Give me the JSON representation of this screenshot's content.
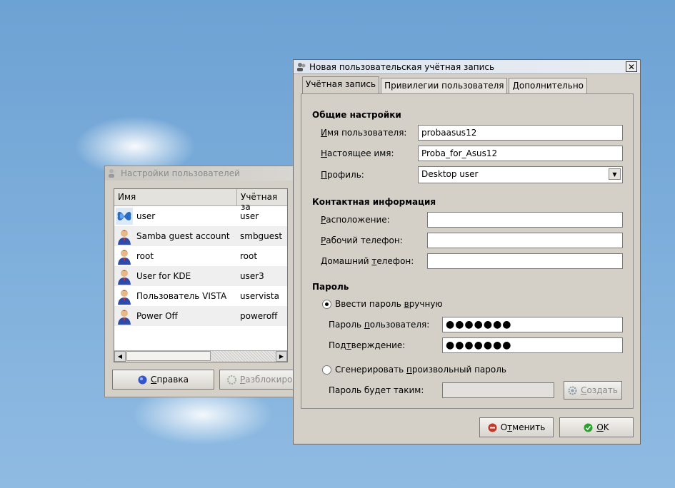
{
  "back_window": {
    "title": "Настройки пользователей",
    "columns": [
      "Имя",
      "Учётная за"
    ],
    "users": [
      {
        "name": "user",
        "account": "user",
        "icon": "butterfly-icon"
      },
      {
        "name": "Samba guest account",
        "account": "smbguest",
        "icon": "user-icon"
      },
      {
        "name": "root",
        "account": "root",
        "icon": "user-icon"
      },
      {
        "name": "User for KDE",
        "account": "user3",
        "icon": "user-icon"
      },
      {
        "name": "Пользователь VISTA",
        "account": "uservista",
        "icon": "user-icon"
      },
      {
        "name": "Power Off",
        "account": "poweroff",
        "icon": "user-icon"
      }
    ],
    "help_button_prefix": "",
    "help_button_mnemonic": "С",
    "help_button_rest": "правка",
    "unlock_button_mnemonic": "Р",
    "unlock_button_rest": "азблокиро"
  },
  "dialog": {
    "title": "Новая пользовательская учётная запись",
    "close_glyph": "✕",
    "tabs": [
      "Учётная запись",
      "Привилегии пользователя",
      "Дополнительно"
    ],
    "general": {
      "heading": "Общие настройки",
      "username_label_m": "И",
      "username_label_rest": "мя пользователя:",
      "username_value": "probaasus12",
      "realname_label_m": "Н",
      "realname_label_rest": "астоящее имя:",
      "realname_value": "Proba_for_Asus12",
      "profile_label_m": "П",
      "profile_label_rest": "рофиль:",
      "profile_value": "Desktop user"
    },
    "contact": {
      "heading": "Контактная информация",
      "location_m": "Р",
      "location_rest": "асположение:",
      "location_value": "",
      "work_phone_m": "Р",
      "work_phone_rest": "абочий телефон:",
      "work_phone_value": "",
      "home_phone_pre": "Домашний ",
      "home_phone_m": "т",
      "home_phone_rest": "елефон:",
      "home_phone_value": ""
    },
    "password": {
      "heading": "Пароль",
      "manual_pre": "Ввести пароль ",
      "manual_m": "в",
      "manual_rest": "ручную",
      "manual_selected": true,
      "user_pw_pre": "Пароль ",
      "user_pw_m": "п",
      "user_pw_rest": "ользователя:",
      "user_pw_value": "●●●●●●●",
      "confirm_pre": "Под",
      "confirm_m": "т",
      "confirm_rest": "верждение:",
      "confirm_value": "●●●●●●●",
      "generate_pre": "Сгенерировать ",
      "generate_m": "п",
      "generate_rest": "роизвольный пароль",
      "generated_label": "Пароль будет таким:",
      "generated_value": "",
      "create_m": "С",
      "create_rest": "оздать"
    },
    "cancel_pre": "О",
    "cancel_m": "т",
    "cancel_rest": "менить",
    "ok_m": "O",
    "ok_rest": "K"
  },
  "colors": {
    "sky": "#7aa9d6",
    "window_bg": "#d4d0c8",
    "cancel_icon": "#c0392b",
    "ok_icon": "#2ea02e",
    "help_icon": "#3355cc"
  }
}
